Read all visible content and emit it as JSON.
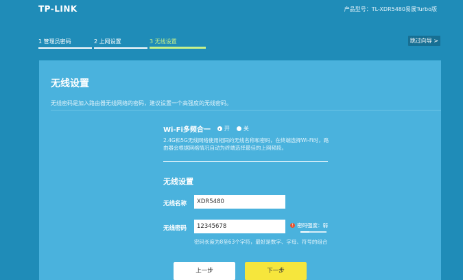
{
  "header": {
    "logo": "TP-LINK",
    "model": "产品型号：TL-XDR5480易展Turbo版"
  },
  "steps": [
    {
      "label": "1 管理员密码",
      "active": false
    },
    {
      "label": "2 上网设置",
      "active": false
    },
    {
      "label": "3 无线设置",
      "active": true
    }
  ],
  "skip_label": "跳过向导 >",
  "panel": {
    "title": "无线设置",
    "desc": "无线密码是加入路由器无线网络的密码，建议设置一个高强度的无线密码。"
  },
  "multiband": {
    "label": "Wi-Fi多频合一",
    "on_label": "开",
    "off_label": "关",
    "selected": "on",
    "desc": "2.4G和5G无线网络使用相同的无线名称和密码，在终端选择Wi-Fi时，路由器会根据网络情况自动为终端选择最佳的上网频段。"
  },
  "wireless": {
    "section_title": "无线设置",
    "ssid_label": "无线名称",
    "ssid_value": "XDR5480",
    "pwd_label": "无线密码",
    "pwd_value": "12345678",
    "strength_label": "密码强度：弱",
    "strength_level": 0.33,
    "hint": "密码长度为8至63个字符，最好是数字、字母、符号的组合"
  },
  "buttons": {
    "prev": "上一步",
    "next": "下一步"
  },
  "colors": {
    "background": "#1f8cb8",
    "panel": "#4ab2dd",
    "active_step": "#c8f28a",
    "next_button": "#f6e63c"
  }
}
